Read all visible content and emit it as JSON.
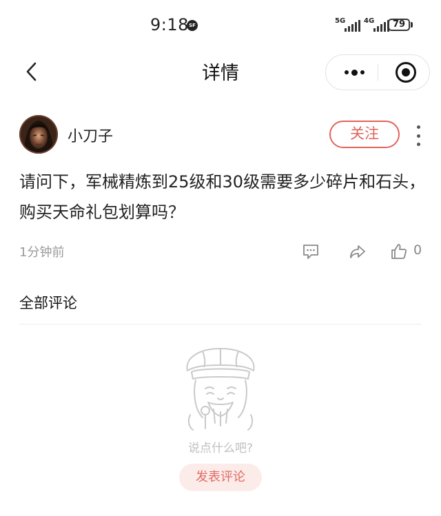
{
  "status_bar": {
    "time": "9:18",
    "sf_badge": "SF",
    "signal_1": "5G",
    "signal_2": "4G",
    "battery": "79"
  },
  "nav": {
    "title": "详情",
    "back_icon": "chevron-left-icon",
    "more_icon": "more-dots-icon",
    "target_icon": "target-icon"
  },
  "post": {
    "username": "小刀子",
    "follow_label": "关注",
    "text": "请问下，军械精炼到25级和30级需要多少碎片和石头，购买天命礼包划算吗？",
    "time": "1分钟前",
    "like_count": "0"
  },
  "comments": {
    "section_title": "全部评论",
    "empty_text": "说点什么吧?",
    "post_comment_label": "发表评论"
  },
  "colors": {
    "accent": "#e0635c",
    "comment_button_bg": "#fbecea",
    "muted_text": "#9a9a9a"
  }
}
